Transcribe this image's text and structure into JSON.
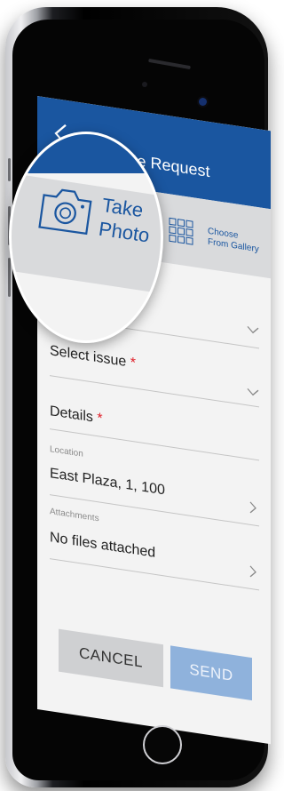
{
  "header": {
    "title": "Create Request"
  },
  "photo_options": {
    "take_photo": {
      "line1": "Take",
      "line2": "Photo"
    },
    "choose_gallery": {
      "line1": "Choose",
      "line2": "From Gallery"
    }
  },
  "form": {
    "category": {
      "label": "y"
    },
    "issue": {
      "label": "Select issue",
      "required_mark": "*"
    },
    "details": {
      "label": "Details",
      "required_mark": "*"
    },
    "location": {
      "caption": "Location",
      "value": "East Plaza, 1, 100"
    },
    "attachments": {
      "caption": "Attachments",
      "value": "No files attached"
    }
  },
  "actions": {
    "cancel": "CANCEL",
    "send": "SEND"
  },
  "colors": {
    "header_blue": "#1a56a0",
    "send_disabled": "#8fb2dc",
    "cancel_gray": "#cfd0d2",
    "required_red": "#e0202a"
  },
  "icons": [
    "back-arrow-icon",
    "camera-icon",
    "gallery-grid-icon",
    "chevron-down-icon",
    "chevron-right-icon"
  ]
}
